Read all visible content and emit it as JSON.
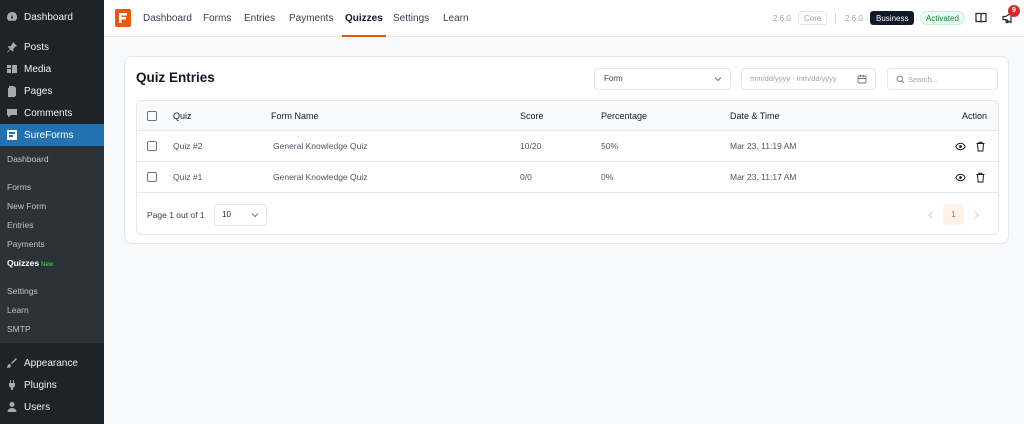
{
  "sidebar": {
    "top_items": [
      {
        "label": "Dashboard",
        "icon": "dashboard-icon"
      },
      {
        "label": "Posts",
        "icon": "pin-icon"
      },
      {
        "label": "Media",
        "icon": "media-icon"
      },
      {
        "label": "Pages",
        "icon": "pages-icon"
      },
      {
        "label": "Comments",
        "icon": "comment-icon"
      },
      {
        "label": "SureForms",
        "icon": "sureforms-icon"
      }
    ],
    "submenu": [
      "Dashboard",
      "Forms",
      "New Form",
      "Entries",
      "Payments",
      "Quizzes",
      "Settings",
      "Learn",
      "SMTP"
    ],
    "new_badge": "New",
    "bottom_items": [
      {
        "label": "Appearance",
        "icon": "appearance-icon"
      },
      {
        "label": "Plugins",
        "icon": "plugins-icon"
      },
      {
        "label": "Users",
        "icon": "users-icon"
      }
    ]
  },
  "topnav": {
    "links": [
      "Dashboard",
      "Forms",
      "Entries",
      "Payments",
      "Quizzes",
      "Settings",
      "Learn"
    ],
    "active": "Quizzes",
    "core_version": "2.6.0",
    "core_label": "Core",
    "business_version": "2.6.0",
    "business_label": "Business",
    "status_label": "Activated",
    "notification_count": "9"
  },
  "page": {
    "title": "Quiz Entries",
    "form_filter": "Form",
    "date_placeholder": "mm/dd/yyyy - mm/dd/yyyy",
    "search_placeholder": "Search..."
  },
  "table": {
    "columns": [
      "Quiz",
      "Form Name",
      "Score",
      "Percentage",
      "Date & Time",
      "Action"
    ],
    "rows": [
      {
        "quiz": "Quiz #2",
        "form": "General Knowledge Quiz",
        "score": "10/20",
        "percentage": "50%",
        "date": "Mar 23, 11:19 AM"
      },
      {
        "quiz": "Quiz #1",
        "form": "General Knowledge Quiz",
        "score": "0/0",
        "percentage": "0%",
        "date": "Mar 23, 11:17 AM"
      }
    ]
  },
  "pagination": {
    "summary": "Page 1 out of 1",
    "per_page": "10",
    "current_page": "1"
  },
  "colors": {
    "accent": "#ea580c",
    "sidebar_bg": "#1d2327",
    "sidebar_active": "#2271b1"
  }
}
